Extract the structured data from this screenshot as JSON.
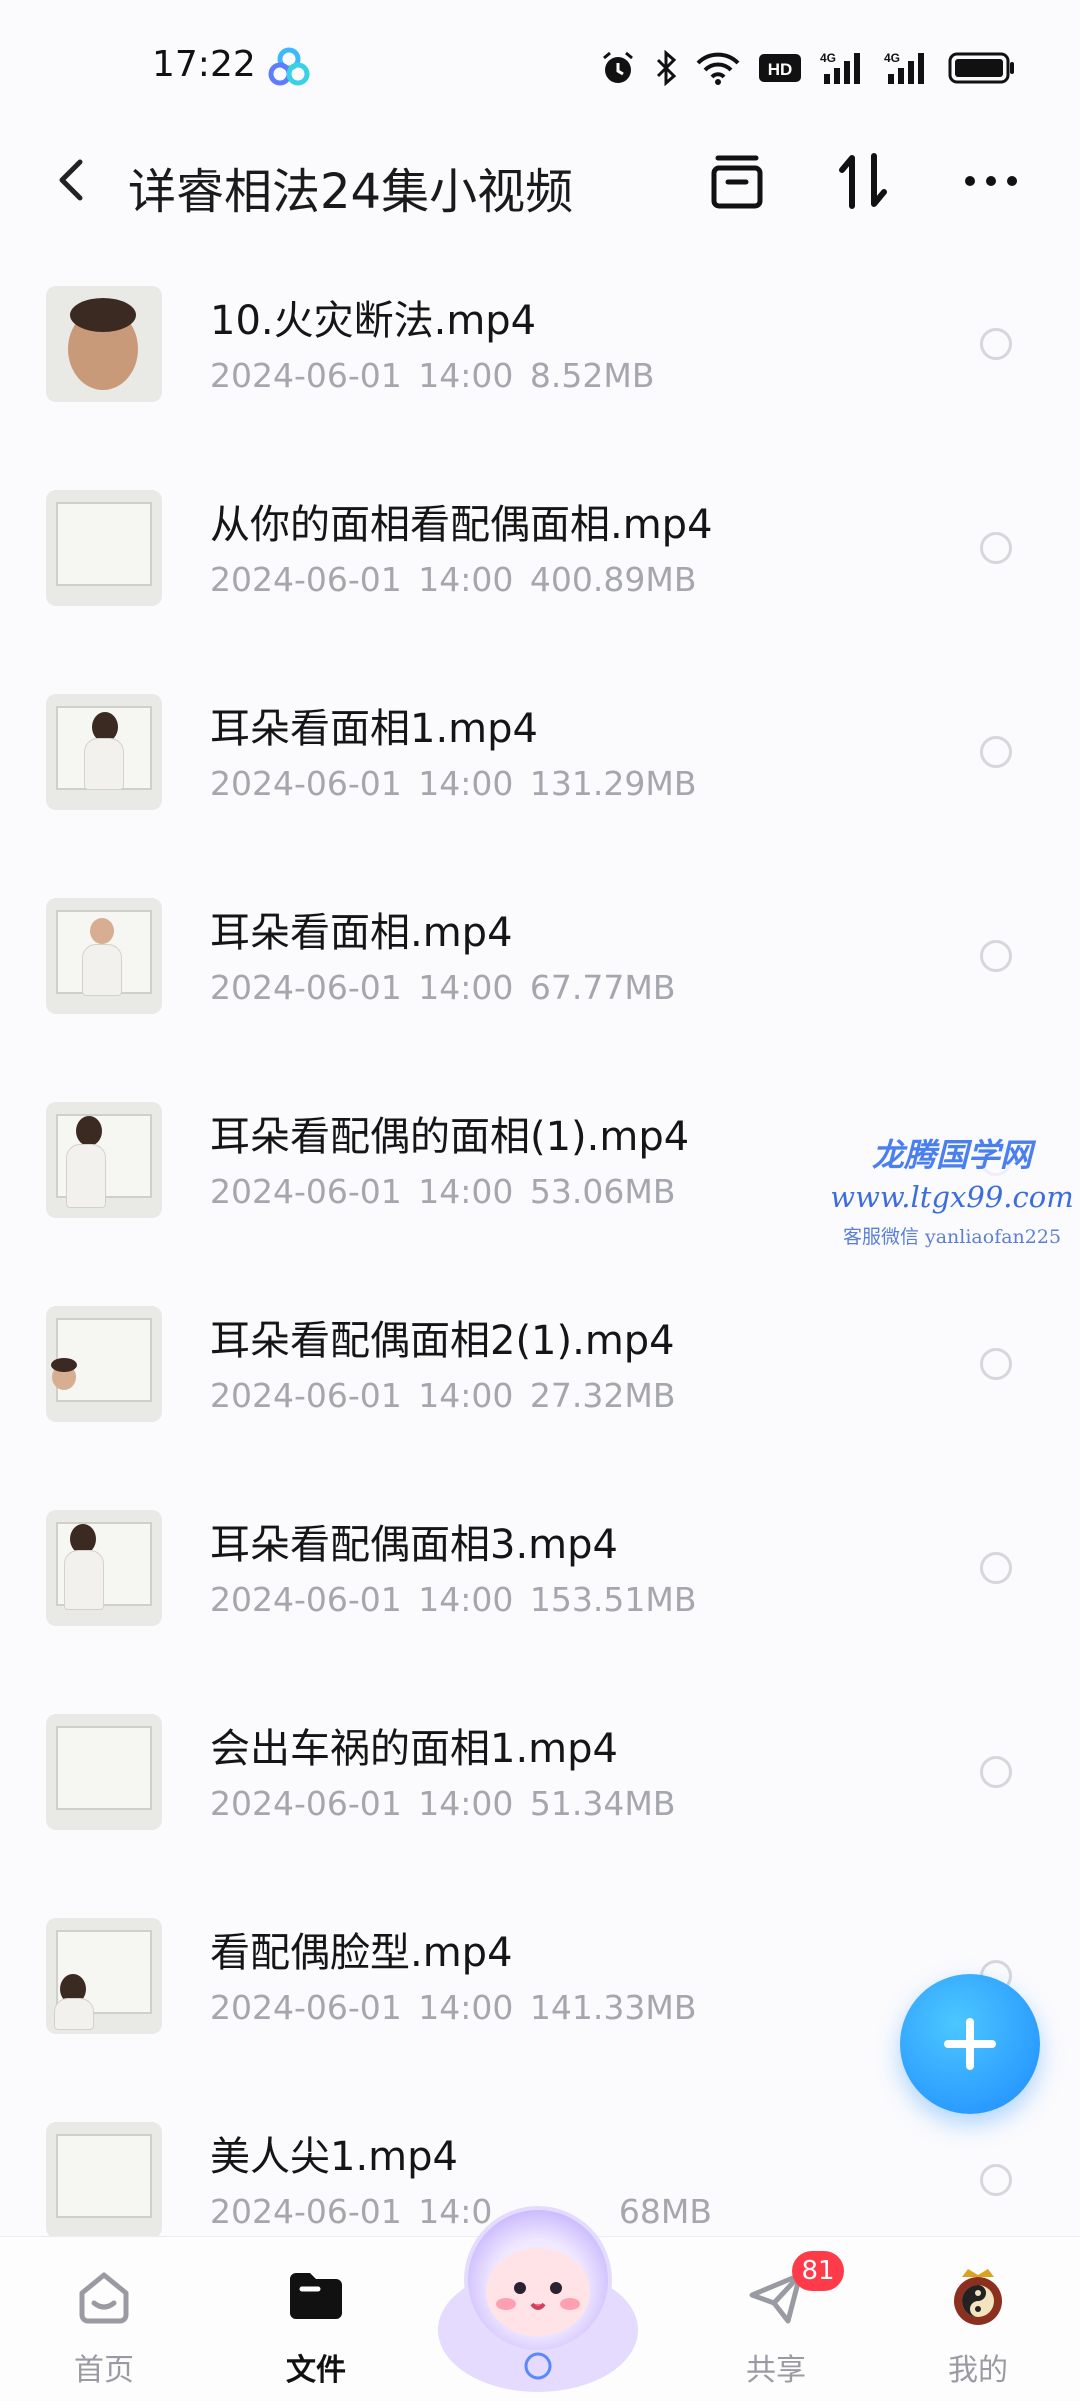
{
  "status_bar": {
    "time": "17:22",
    "icons": [
      "app-cloud-icon",
      "alarm-icon",
      "bluetooth-icon",
      "wifi-icon",
      "hd-icon",
      "signal-4g-icon",
      "signal-4g-icon",
      "battery-icon"
    ],
    "hd_label": "HD",
    "network_label": "4G"
  },
  "header": {
    "title": "详睿相法24集小视频",
    "actions": [
      "select-icon",
      "sort-icon",
      "more-icon"
    ]
  },
  "files": [
    {
      "name": "10.火灾断法.mp4",
      "date": "2024-06-01",
      "time": "14:00",
      "size": "8.52MB"
    },
    {
      "name": "从你的面相看配偶面相.mp4",
      "date": "2024-06-01",
      "time": "14:00",
      "size": "400.89MB"
    },
    {
      "name": "耳朵看面相1.mp4",
      "date": "2024-06-01",
      "time": "14:00",
      "size": "131.29MB"
    },
    {
      "name": "耳朵看面相.mp4",
      "date": "2024-06-01",
      "time": "14:00",
      "size": "67.77MB"
    },
    {
      "name": "耳朵看配偶的面相(1).mp4",
      "date": "2024-06-01",
      "time": "14:00",
      "size": "53.06MB"
    },
    {
      "name": "耳朵看配偶面相2(1).mp4",
      "date": "2024-06-01",
      "time": "14:00",
      "size": "27.32MB"
    },
    {
      "name": "耳朵看配偶面相3.mp4",
      "date": "2024-06-01",
      "time": "14:00",
      "size": "153.51MB"
    },
    {
      "name": "会出车祸的面相1.mp4",
      "date": "2024-06-01",
      "time": "14:00",
      "size": "51.34MB"
    },
    {
      "name": "看配偶脸型.mp4",
      "date": "2024-06-01",
      "time": "14:00",
      "size": "141.33MB"
    },
    {
      "name": "美人尖1.mp4",
      "date": "2024-06-01",
      "time": "14:0",
      "size": "68MB"
    }
  ],
  "watermark": {
    "line1": "龙腾国学网",
    "line2": "www.ltgx99.com",
    "line3": "客服微信 yanliaofan225"
  },
  "fab": {
    "icon": "plus-icon"
  },
  "bottom_nav": {
    "items": [
      {
        "label": "首页",
        "icon": "home-icon"
      },
      {
        "label": "文件",
        "icon": "folder-icon"
      },
      {
        "label": "",
        "icon": "mascot-icon"
      },
      {
        "label": "共享",
        "icon": "share-icon",
        "badge": "81"
      },
      {
        "label": "我的",
        "icon": "avatar-icon"
      }
    ]
  },
  "colors": {
    "accent": "#1e8bff",
    "badge": "#ff3b4a",
    "meta_text": "#a6a6ad",
    "background": "#fbfbfd"
  }
}
